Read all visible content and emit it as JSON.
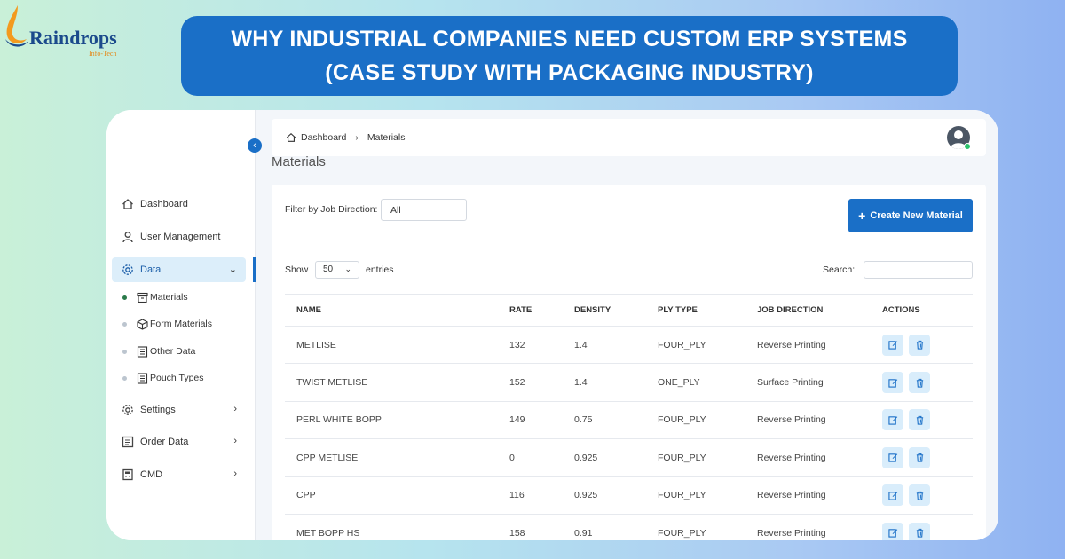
{
  "logo": {
    "name": "Raindrops",
    "tagline": "Info-Tech"
  },
  "banner": {
    "line1": "WHY INDUSTRIAL COMPANIES NEED CUSTOM ERP SYSTEMS",
    "line2": "(CASE STUDY WITH PACKAGING INDUSTRY)"
  },
  "sidebar": {
    "items": [
      {
        "label": "Dashboard",
        "icon": "home-icon"
      },
      {
        "label": "User Management",
        "icon": "user-icon"
      },
      {
        "label": "Data",
        "icon": "gear-icon",
        "active": true,
        "expanded": true
      },
      {
        "label": "Settings",
        "icon": "gear-icon"
      },
      {
        "label": "Order Data",
        "icon": "list-icon"
      },
      {
        "label": "CMD",
        "icon": "calculator-icon"
      }
    ],
    "subitems": [
      {
        "label": "Materials",
        "icon": "archive-icon",
        "active": true
      },
      {
        "label": "Form Materials",
        "icon": "cube-icon"
      },
      {
        "label": "Other Data",
        "icon": "list-icon"
      },
      {
        "label": "Pouch Types",
        "icon": "list-icon"
      }
    ]
  },
  "breadcrumb": {
    "home": "Dashboard",
    "current": "Materials"
  },
  "page_title": "Materials",
  "filter": {
    "label": "Filter by Job Direction:",
    "value": "All"
  },
  "create_button": "Create New Material",
  "table_controls": {
    "show": "Show",
    "entries_value": "50",
    "entries": "entries",
    "search": "Search:"
  },
  "table": {
    "columns": [
      "NAME",
      "RATE",
      "DENSITY",
      "PLY TYPE",
      "JOB DIRECTION",
      "ACTIONS"
    ],
    "rows": [
      [
        "METLISE",
        "132",
        "1.4",
        "FOUR_PLY",
        "Reverse Printing"
      ],
      [
        "TWIST METLISE",
        "152",
        "1.4",
        "ONE_PLY",
        "Surface Printing"
      ],
      [
        "PERL WHITE BOPP",
        "149",
        "0.75",
        "FOUR_PLY",
        "Reverse Printing"
      ],
      [
        "CPP METLISE",
        "0",
        "0.925",
        "FOUR_PLY",
        "Reverse Printing"
      ],
      [
        "CPP",
        "116",
        "0.925",
        "FOUR_PLY",
        "Reverse Printing"
      ],
      [
        "MET BOPP HS",
        "158",
        "0.91",
        "FOUR_PLY",
        "Reverse Printing"
      ]
    ]
  },
  "colors": {
    "accent": "#1a6fc7",
    "active_bg": "#dceefa",
    "status_online": "#2bc26b"
  }
}
